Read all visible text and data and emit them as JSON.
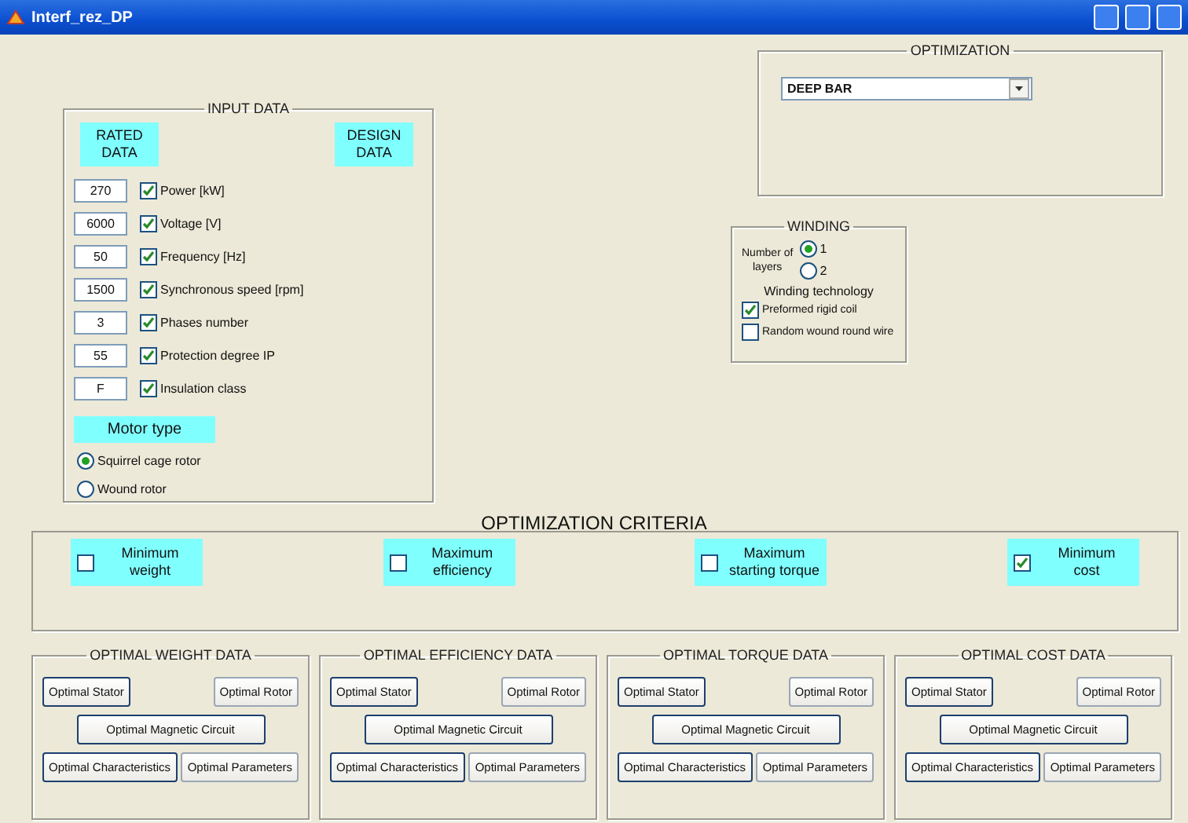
{
  "window": {
    "title": "Interf_rez_DP"
  },
  "input_data": {
    "title": "INPUT DATA",
    "headers": [
      "RATED\nDATA",
      "DESIGN\nDATA"
    ],
    "fields": [
      {
        "value": "270",
        "label": "Power [kW]",
        "checked": true
      },
      {
        "value": "6000",
        "label": "Voltage [V]",
        "checked": true
      },
      {
        "value": "50",
        "label": "Frequency [Hz]",
        "checked": true
      },
      {
        "value": "1500",
        "label": "Synchronous speed [rpm]",
        "checked": true
      },
      {
        "value": "3",
        "label": "Phases number",
        "checked": true
      },
      {
        "value": "55",
        "label": "Protection degree IP",
        "checked": true
      },
      {
        "value": "F",
        "label": "Insulation class",
        "checked": true
      }
    ],
    "motor_type": {
      "label": "Motor type",
      "options": [
        {
          "label": "Squirrel cage rotor",
          "selected": true
        },
        {
          "label": "Wound rotor",
          "selected": false
        }
      ]
    }
  },
  "optimization": {
    "title": "OPTIMIZATION",
    "dropdown": "DEEP BAR"
  },
  "winding": {
    "title": "WINDING",
    "layers_label": "Number of\nlayers",
    "layers": [
      {
        "label": "1",
        "selected": true
      },
      {
        "label": "2",
        "selected": false
      }
    ],
    "technology_label": "Winding technology",
    "options": [
      {
        "label": "Preformed rigid coil",
        "checked": true
      },
      {
        "label": "Random wound round wire",
        "checked": false
      }
    ]
  },
  "criteria": {
    "title": "OPTIMIZATION CRITERIA",
    "items": [
      {
        "label": "Minimum\nweight",
        "checked": false
      },
      {
        "label": "Maximum\nefficiency",
        "checked": false
      },
      {
        "label": "Maximum\nstarting torque",
        "checked": false
      },
      {
        "label": "Minimum\ncost",
        "checked": true
      }
    ]
  },
  "results": [
    {
      "title": "OPTIMAL WEIGHT DATA",
      "buttons": [
        "Optimal Stator",
        "Optimal Rotor",
        "Optimal Magnetic Circuit",
        "Optimal Characteristics",
        "Optimal Parameters"
      ]
    },
    {
      "title": "OPTIMAL EFFICIENCY DATA",
      "buttons": [
        "Optimal Stator",
        "Optimal Rotor",
        "Optimal Magnetic Circuit",
        "Optimal Characteristics",
        "Optimal Parameters"
      ]
    },
    {
      "title": "OPTIMAL TORQUE DATA",
      "buttons": [
        "Optimal Stator",
        "Optimal Rotor",
        "Optimal Magnetic Circuit",
        "Optimal Characteristics",
        "Optimal Parameters"
      ]
    },
    {
      "title": "OPTIMAL COST DATA",
      "buttons": [
        "Optimal Stator",
        "Optimal Rotor",
        "Optimal Magnetic Circuit",
        "Optimal Characteristics",
        "Optimal Parameters"
      ]
    }
  ]
}
